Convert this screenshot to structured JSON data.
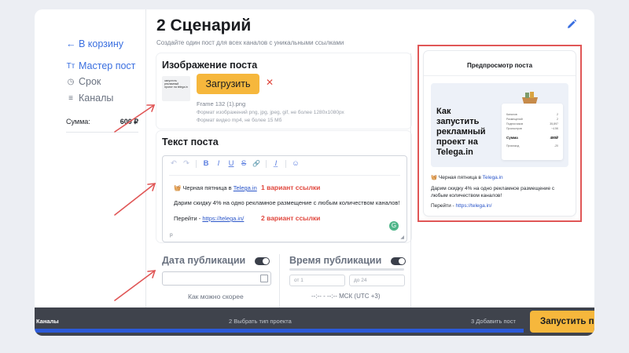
{
  "sidebar": {
    "back_label": "← В корзину",
    "items": [
      {
        "icon": "text-icon",
        "glyph": "Tт",
        "label": "Мастер пост",
        "active": true
      },
      {
        "icon": "clock-icon",
        "glyph": "◷",
        "label": "Срок",
        "active": false
      },
      {
        "icon": "list-icon",
        "glyph": "≡",
        "label": "Каналы",
        "active": false
      }
    ],
    "sum_label": "Сумма:",
    "sum_value": "600 ₽"
  },
  "header": {
    "title": "2 Сценарий",
    "subtitle": "Создайте один пост для всех каналов с уникальными ссылками"
  },
  "image_section": {
    "title": "Изображение поста",
    "thumb_text": "запустить рекламный проект на telega.in",
    "upload_label": "Загрузить",
    "remove_glyph": "✕",
    "file_name": "Frame 132 (1).png",
    "hint_image": "Формат изображений png, jpg, jpeg, gif, не более 1280x1080px",
    "hint_video": "Формат видео mp4, не более 15 Мб"
  },
  "text_section": {
    "title": "Текст поста",
    "toolbar": [
      "↶",
      "↷",
      "B",
      "I",
      "U",
      "S",
      "🔗",
      "I̲",
      "☺"
    ],
    "line1_prefix": "🧺 Черная пятница в ",
    "line1_link": "Telega.in",
    "line2": "Дарим скидку 4% на одно рекламное размещение с любым количеством каналов!",
    "line3_prefix": "Перейти - ",
    "line3_link": "https://telega.in/",
    "variant1": "1 вариант ссылки",
    "variant2": "2 вариант ссылки",
    "p_tag": "p",
    "grammar_glyph": "G"
  },
  "schedule": {
    "date_label": "Дата публикации",
    "time_label": "Время публикации",
    "asap": "Как можно скорее",
    "from_placeholder": "от  1",
    "to_placeholder": "до  24",
    "timezone": "--:-- - --:-- МСК (UTC +3)"
  },
  "preview": {
    "title": "Предпросмотр поста",
    "promo_headline": "Как запустить рекламный проект на Telega.in",
    "promo_rows": [
      {
        "label": "Каналов",
        "value": "2"
      },
      {
        "label": "Размещений",
        "value": "2"
      },
      {
        "label": "Подписчиков",
        "value": "35,897"
      },
      {
        "label": "Просмотров",
        "value": "~4.5К"
      }
    ],
    "promo_sum_label": "Сумма",
    "promo_sum_value": "480₽",
    "promo_code_label": "Промокод",
    "promo_code_value": "-20",
    "line1_prefix": "🧺 Черная пятница в ",
    "line1_link": "Telega.in",
    "line2": "Дарим скидку 4% на одно рекламное размещение с любым количеством каналов!",
    "line3_prefix": "Перейти - ",
    "line3_link": "https://telega.in/"
  },
  "bottom": {
    "step1": "Каналы",
    "step2": "2 Выбрать тип проекта",
    "step3": "3 Добавить пост",
    "launch_label": "Запустить п"
  },
  "colors": {
    "accent": "#3a6fe0",
    "button": "#f6b73c",
    "annotation": "#e05656"
  }
}
